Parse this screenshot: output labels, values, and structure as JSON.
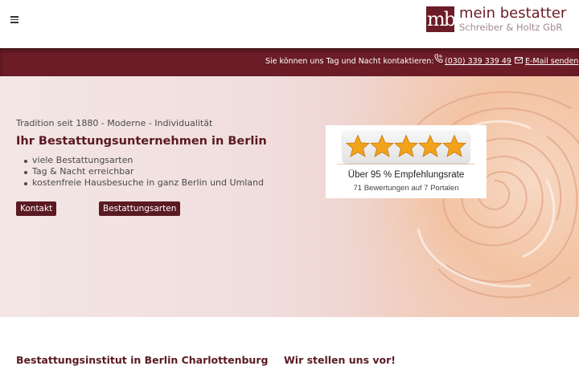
{
  "header": {
    "menu_icon": "hamburger-menu-icon",
    "logo": {
      "mark": "mb",
      "title": "mein bestatter",
      "subtitle": "Schreiber & Holtz GbR"
    }
  },
  "contact_bar": {
    "text": "Sie können uns Tag und Nacht kontaktieren:",
    "phone": "(030) 339 339 49",
    "phone_icon": "phone-icon",
    "email": "E-Mail senden",
    "email_icon": "envelope-icon"
  },
  "hero": {
    "tagline": "Tradition seit 1880 - Moderne - Individualität",
    "headline": "Ihr Bestattungsunternehmen in Berlin",
    "bullets": [
      "viele Bestattungsarten",
      "Tag & Nacht erreichbar",
      "kostenfreie Hausbesuche in ganz Berlin und Umland"
    ],
    "buttons": {
      "kontakt": "Kontakt",
      "bestattungsarten": "Bestattungsarten"
    }
  },
  "rating": {
    "stars": 5,
    "title": "Über 95 % Empfehlungsrate",
    "subtitle": "71 Bewertungen auf 7 Portalen"
  },
  "sections": {
    "left_title": "Bestattungsinstitut in Berlin Charlottenburg",
    "right_title": "Wir stellen uns vor!"
  },
  "colors": {
    "brand": "#6b1c26",
    "button": "#5a1a22",
    "star": "#f3a21c"
  }
}
